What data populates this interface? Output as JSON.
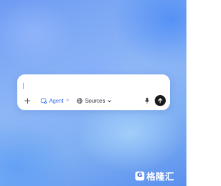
{
  "composer": {
    "input_value": "",
    "agent_chip": {
      "label": "Agent",
      "close_symbol": "×"
    },
    "sources_chip": {
      "label": "Sources"
    }
  },
  "watermark": {
    "mark": "G",
    "text": "格隆汇"
  },
  "colors": {
    "accent": "#3b6ff5",
    "send_button": "#1a1a1a",
    "card": "#ffffff"
  },
  "icons": [
    "plus-icon",
    "agent-icon",
    "globe-icon",
    "chevron-down-icon",
    "microphone-icon",
    "arrow-up-icon"
  ]
}
